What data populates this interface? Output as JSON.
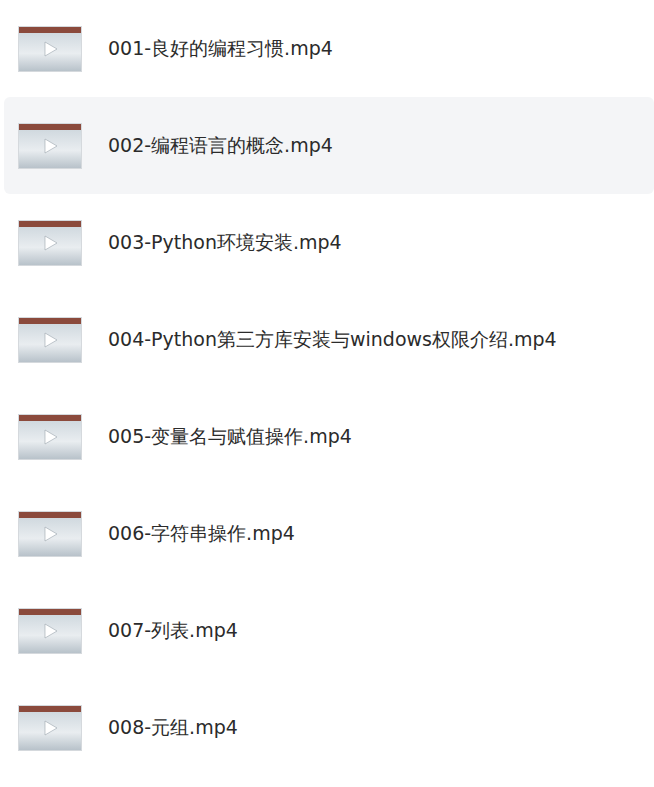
{
  "files": [
    {
      "name": "001-良好的编程习惯.mp4",
      "selected": false
    },
    {
      "name": "002-编程语言的概念.mp4",
      "selected": true
    },
    {
      "name": "003-Python环境安装.mp4",
      "selected": false
    },
    {
      "name": "004-Python第三方库安装与windows权限介绍.mp4",
      "selected": false
    },
    {
      "name": "005-变量名与赋值操作.mp4",
      "selected": false
    },
    {
      "name": "006-字符串操作.mp4",
      "selected": false
    },
    {
      "name": "007-列表.mp4",
      "selected": false
    },
    {
      "name": "008-元组.mp4",
      "selected": false
    }
  ]
}
